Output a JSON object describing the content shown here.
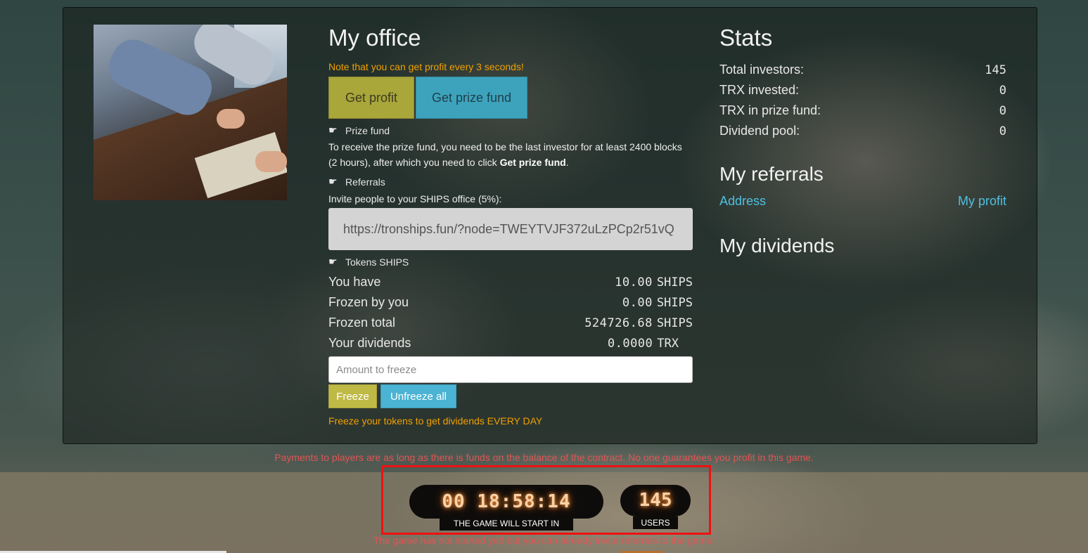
{
  "office": {
    "title": "My office",
    "note": "Note that you can get profit every 3 seconds!",
    "get_profit_label": "Get profit",
    "get_prize_label": "Get prize fund",
    "prize_fund_heading": "Prize fund",
    "prize_fund_text": "To receive the prize fund, you need to be the last investor for at least 2400 blocks (2 hours), after which you need to click ",
    "prize_fund_bold": "Get prize fund",
    "prize_fund_end": ".",
    "referrals_heading": "Referrals",
    "invite_text": "Invite people to your SHIPS office (5%):",
    "ref_link": "https://tronships.fun/?node=TWEYTVJF372uLzPCp2r51vQ",
    "tokens_heading": "Tokens SHIPS",
    "rows": [
      {
        "label": "You have",
        "value": "10.00",
        "unit": "SHIPS"
      },
      {
        "label": "Frozen by you",
        "value": "0.00",
        "unit": "SHIPS"
      },
      {
        "label": "Frozen total",
        "value": "524726.68",
        "unit": "SHIPS"
      },
      {
        "label": "Your dividends",
        "value": "0.0000",
        "unit": "TRX"
      }
    ],
    "amount_placeholder": "Amount to freeze",
    "freeze_label": "Freeze",
    "unfreeze_label": "Unfreeze all",
    "freeze_note": "Freeze your tokens to get dividends EVERY DAY"
  },
  "stats": {
    "title": "Stats",
    "rows": [
      {
        "label": "Total investors:",
        "value": "145"
      },
      {
        "label": "TRX invested:",
        "value": "0"
      },
      {
        "label": "TRX in prize fund:",
        "value": "0"
      },
      {
        "label": "Dividend pool:",
        "value": "0"
      }
    ]
  },
  "referrals": {
    "title": "My referrals",
    "col_address": "Address",
    "col_profit": "My profit"
  },
  "dividends": {
    "title": "My dividends"
  },
  "footer": {
    "warning": "Payments to players are as long as there is funds on the balance of the contract. No one guarantees you profit in this game.",
    "timer": "00 18:58:14",
    "timer_label": "THE GAME WILL START IN",
    "users": "145",
    "users_label": "USERS",
    "not_started": "The game has not started yet! but you can already invite referrals to the game!"
  },
  "colors": {
    "accent_orange": "#f0a000",
    "link_blue": "#4fc0e0",
    "warning_red": "#e05555",
    "highlight_red": "#ee1111"
  },
  "icons": [
    "hand-point-right-icon"
  ]
}
